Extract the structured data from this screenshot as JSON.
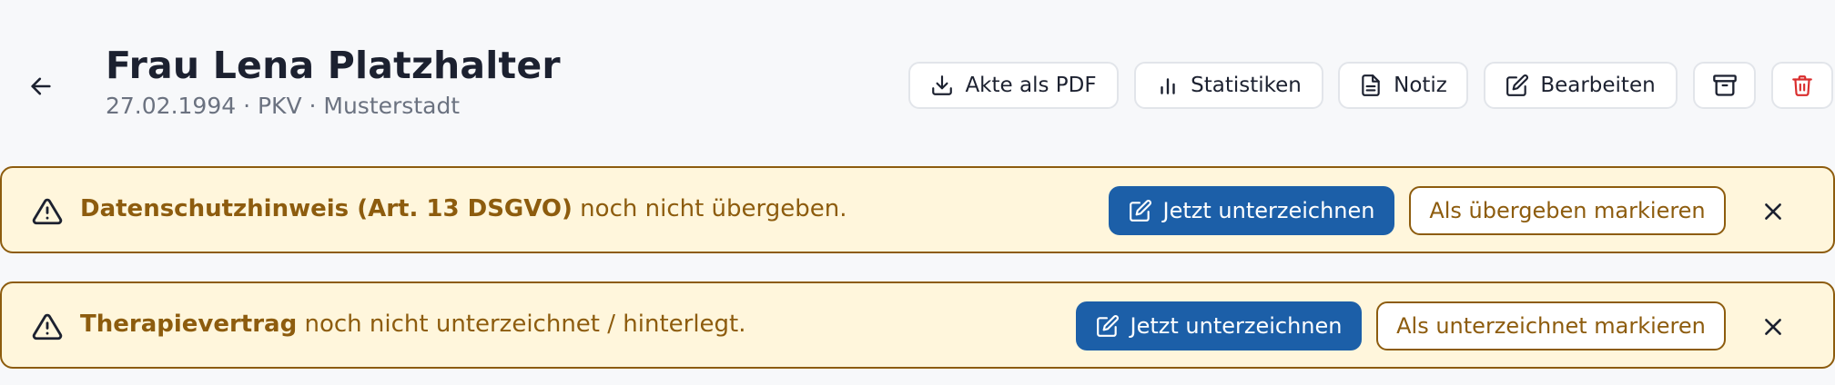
{
  "patient": {
    "name": "Frau Lena Platzhalter",
    "meta": "27.02.1994 · PKV · Musterstadt"
  },
  "toolbar": {
    "pdf_label": "Akte als PDF",
    "stats_label": "Statistiken",
    "note_label": "Notiz",
    "edit_label": "Bearbeiten"
  },
  "alerts": [
    {
      "title": "Datenschutzhinweis (Art. 13 DSGVO)",
      "text": " noch nicht übergeben.",
      "primary_label": "Jetzt unterzeichnen",
      "secondary_label": "Als übergeben markieren"
    },
    {
      "title": "Therapievertrag",
      "text": " noch nicht unterzeichnet / hinterlegt.",
      "primary_label": "Jetzt unterzeichnen",
      "secondary_label": "Als unterzeichnet markieren"
    }
  ],
  "colors": {
    "primary": "#1c5fa8",
    "warning_text": "#8d5c0e",
    "warning_bg": "#fff6dc",
    "danger": "#d92d2d"
  },
  "icons": [
    "arrow-left-icon",
    "download-icon",
    "bar-chart-icon",
    "file-text-icon",
    "edit-icon",
    "archive-icon",
    "trash-icon",
    "warning-triangle-icon",
    "close-icon"
  ]
}
